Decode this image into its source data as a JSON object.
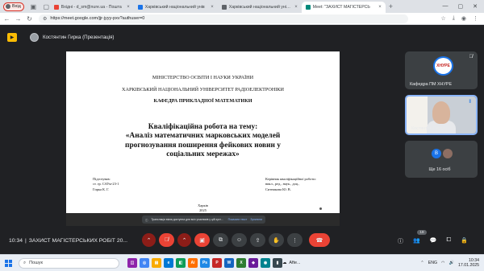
{
  "browser": {
    "profile_label": "Вхід",
    "tabs": [
      {
        "label": "Вхідні - d_sm@nure.ua - Пошта",
        "fav_color": "#ea4335",
        "active": false
      },
      {
        "label": "Харківський національний унів",
        "fav_color": "#1a73e8",
        "active": false
      },
      {
        "label": "Харківський національний універс",
        "fav_color": "#5f6368",
        "active": false
      },
      {
        "label": "Meet: \"ЗАХИСТ МАГІСТЕРСЬ",
        "fav_color": "#00897b",
        "active": true
      }
    ],
    "url": "https://meet.google.com/jjr-jyyy-pxv?authuser=0"
  },
  "meet": {
    "presenter_label": "Костянтин Гирка (Презентація)",
    "time": "10:34",
    "separator": "|",
    "meeting_title": "ЗАХИСТ МАГІСТЕРСЬКИХ РОБІТ 20...",
    "participants_badge": "19"
  },
  "slide": {
    "ministry": "МІНІСТЕРСТВО ОСВІТИ І НАУКИ УКРАЇНИ",
    "university": "ХАРКІВСЬКИЙ НАЦІОНАЛЬНИЙ УНІВЕРСИТЕТ РАДІОЕЛЕКТРОНІКИ",
    "department": "КАФЕДРА ПРИКЛАДНОЇ МАТЕМАТИКИ",
    "title_line1": "Кваліфікаційна робота на тему:",
    "title_line2": "«Аналіз математичних марковських моделей",
    "title_line3": "прогнозування поширення фейкових новин у",
    "title_line4": "соціальних мережах»",
    "left_line1": "Підготував:",
    "left_line2": "ст. гр. САУм-23-1",
    "left_line3": "Гирка К. Г.",
    "right_line1": "Керівник кваліфікаційної роботи:",
    "right_line2": "викл., ред., наук., доц.,",
    "right_line3": "Ситникова Ю. В.",
    "city": "Харків",
    "year": "2025"
  },
  "share_notice": {
    "message": "Трансляція вікна доступна для всіх учасників у цій зустрічі",
    "action_primary": "Показати текст",
    "action_secondary": "Зупинити"
  },
  "tiles": {
    "tile1_logo": "ХНУРЕ",
    "tile1_label": "Кафедра ПМ ХНУРЕ",
    "tile2_label": "Костянтин Гирка",
    "tile3_avatar_letter": "B",
    "tile3_label": "Ще 16 осіб"
  },
  "taskbar": {
    "search_placeholder": "Пошук",
    "weather": "Afte...",
    "lang": "ENG",
    "time": "10:34",
    "date": "17.01.2025"
  }
}
